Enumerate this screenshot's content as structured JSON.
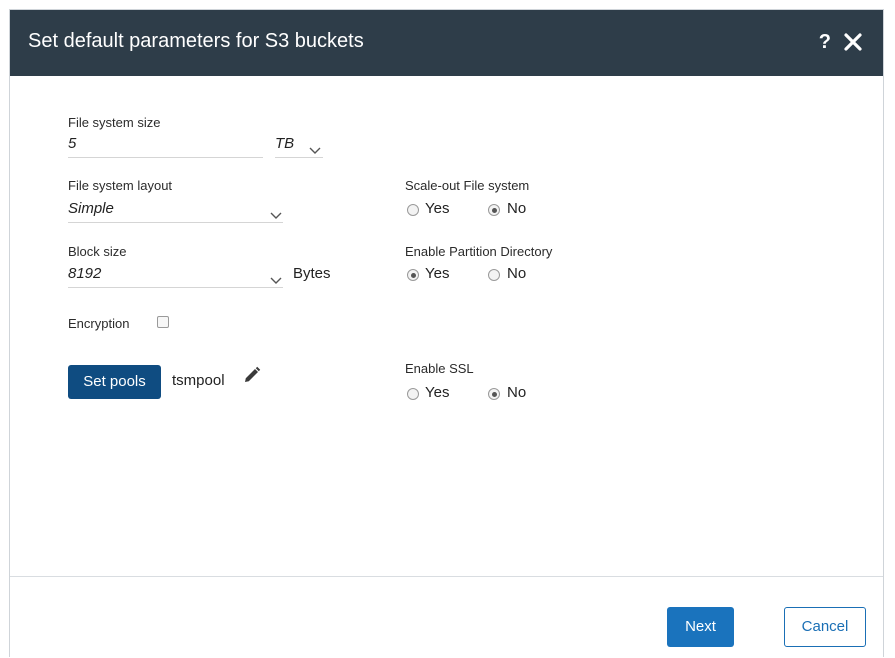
{
  "dialog": {
    "title": "Set default parameters for S3 buckets",
    "help_label": "?",
    "close_icon": "close-icon"
  },
  "form": {
    "fs_size": {
      "label": "File system size",
      "value": "5",
      "unit": "TB"
    },
    "fs_layout": {
      "label": "File system layout",
      "value": "Simple"
    },
    "block_size": {
      "label": "Block size",
      "value": "8192",
      "unit": "Bytes"
    },
    "encryption": {
      "label": "Encryption",
      "checked": false
    },
    "pools": {
      "button_label": "Set pools",
      "value": "tsmpool",
      "edit_icon": "pencil-icon"
    },
    "scale_out": {
      "label": "Scale-out File system",
      "yes": "Yes",
      "no": "No",
      "selected": "No"
    },
    "partition_dir": {
      "label": "Enable Partition Directory",
      "yes": "Yes",
      "no": "No",
      "selected": "Yes"
    },
    "ssl": {
      "label": "Enable SSL",
      "yes": "Yes",
      "no": "No",
      "selected": "No"
    }
  },
  "footer": {
    "next_label": "Next",
    "cancel_label": "Cancel"
  },
  "colors": {
    "header_bg": "#2e3d49",
    "primary": "#0f4c81",
    "next": "#1a73bd",
    "cancel_border": "#1a6fb5"
  }
}
